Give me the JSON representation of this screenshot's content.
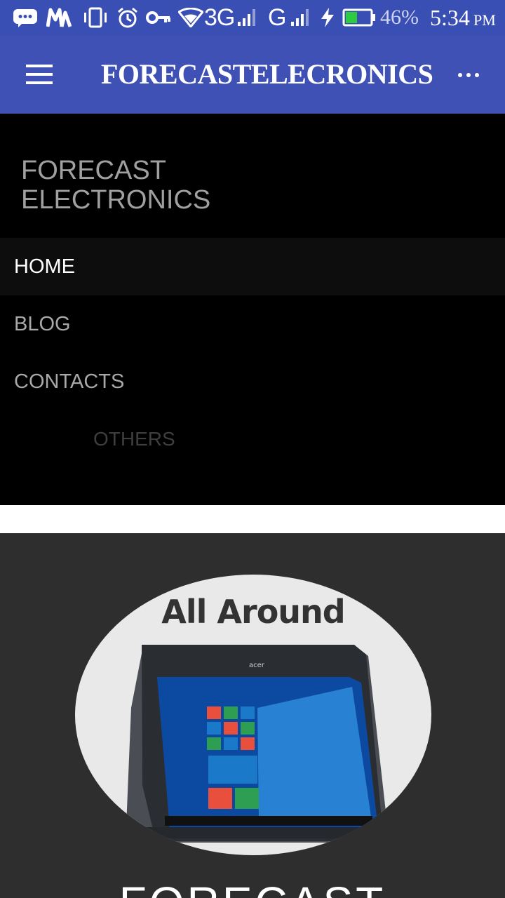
{
  "status_bar": {
    "network_3g": "3G",
    "network_g": "G",
    "battery_percent": "46%",
    "battery_level": 0.46,
    "time": "5:34",
    "ampm": "PM",
    "icons": [
      "messages-icon",
      "mtn-icon",
      "vibrate-icon",
      "alarm-icon",
      "vpn-key-icon",
      "wifi-icon",
      "signal-icon",
      "signal-icon",
      "charging-icon",
      "battery-icon"
    ]
  },
  "app_bar": {
    "title": "FORECASTELECRONICS",
    "background": "#3f51b5",
    "status_background": "#3a4fb4"
  },
  "drawer": {
    "brand_line1": "FORECAST",
    "brand_line2": "ELECTRONICS",
    "items": [
      {
        "label": "HOME",
        "active": true
      },
      {
        "label": "BLOG"
      },
      {
        "label": "CONTACTS"
      }
    ],
    "others_label": "OTHERS"
  },
  "hero": {
    "logo_text": "All Around",
    "laptop_brand": "acer",
    "title": "FORECAST",
    "background": "#2e2e2e"
  }
}
